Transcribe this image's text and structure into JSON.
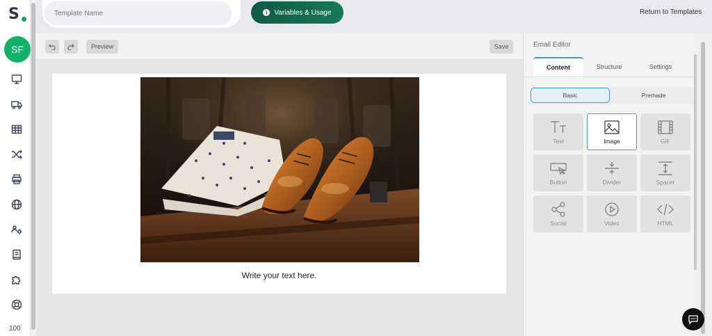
{
  "brand": {
    "logo_text": "S",
    "accent_color": "#13b26b"
  },
  "user": {
    "initials": "SF"
  },
  "sidebar": {
    "icons": [
      "monitor-icon",
      "truck-icon",
      "table-icon",
      "shuffle-icon",
      "print-icon",
      "globe-icon",
      "people-settings-icon",
      "book-icon",
      "puzzle-icon",
      "lifebuoy-icon"
    ],
    "zoom": "100"
  },
  "header": {
    "template_name_placeholder": "Template Name",
    "variables_label": "Variables & Usage",
    "return_label": "Return to Templates"
  },
  "toolbar": {
    "preview_label": "Preview",
    "save_label": "Save"
  },
  "email": {
    "body_text": "Write your text here."
  },
  "panel": {
    "title": "Email Editor",
    "tabs": [
      {
        "label": "Content",
        "active": true
      },
      {
        "label": "Structure",
        "active": false
      },
      {
        "label": "Settings",
        "active": false
      }
    ],
    "segments": [
      {
        "label": "Basic",
        "active": true
      },
      {
        "label": "Premade",
        "active": false
      }
    ],
    "blocks": [
      {
        "label": "Text",
        "icon": "text-icon"
      },
      {
        "label": "Image",
        "icon": "image-icon",
        "selected": true
      },
      {
        "label": "GIF",
        "icon": "gif-icon"
      },
      {
        "label": "Button",
        "icon": "button-icon"
      },
      {
        "label": "Divider",
        "icon": "divider-icon"
      },
      {
        "label": "Spacer",
        "icon": "spacer-icon"
      },
      {
        "label": "Social",
        "icon": "share-icon"
      },
      {
        "label": "Video",
        "icon": "video-icon"
      },
      {
        "label": "HTML",
        "icon": "code-icon"
      }
    ]
  }
}
